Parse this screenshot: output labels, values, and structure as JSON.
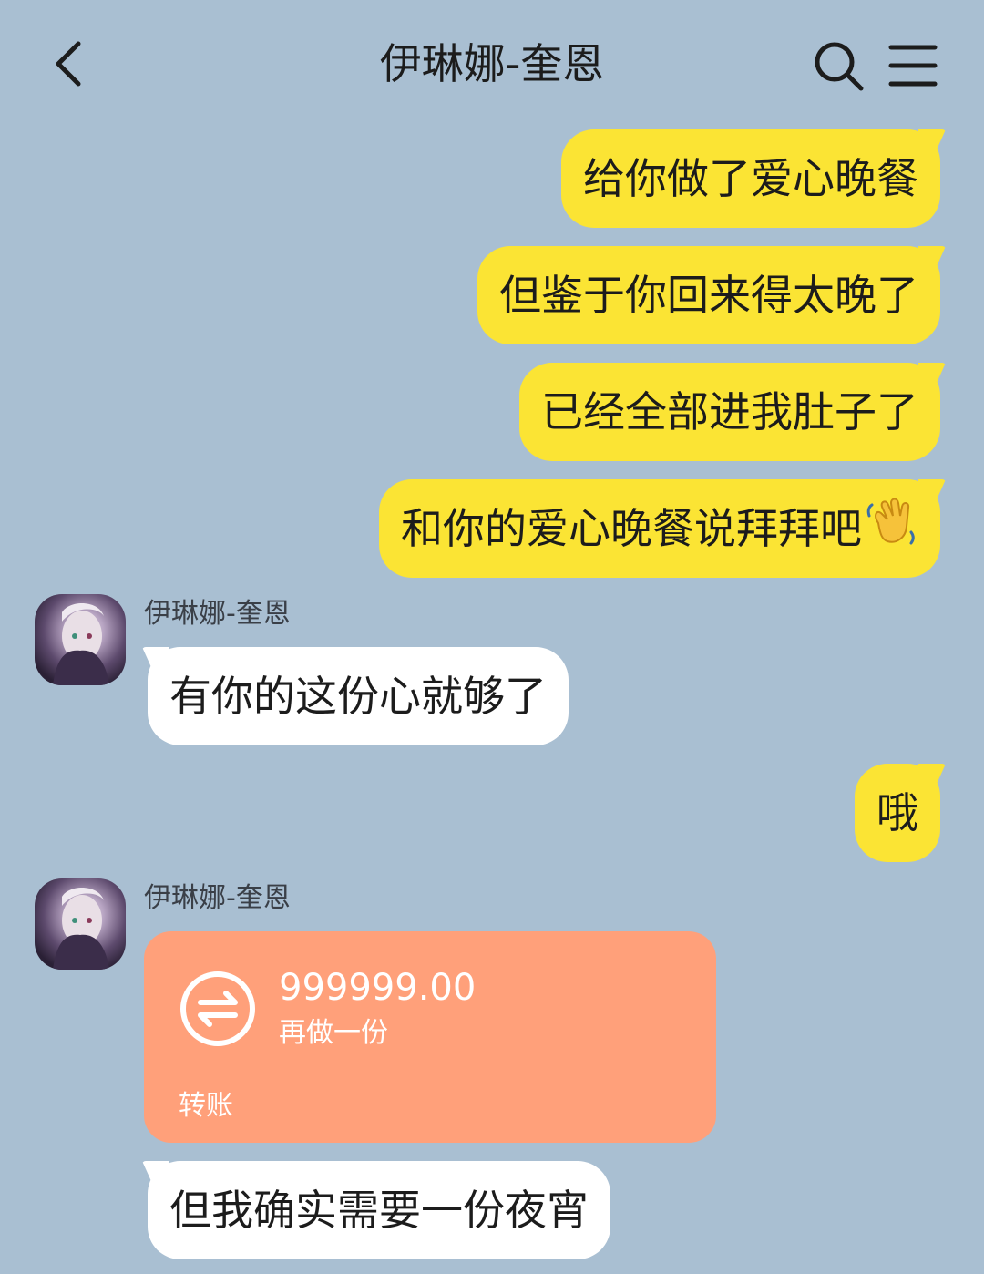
{
  "header": {
    "title": "伊琳娜-奎恩",
    "back_icon": "chevron-left-icon",
    "search_icon": "search-icon",
    "menu_icon": "menu-icon"
  },
  "messages": [
    {
      "side": "out",
      "text": "给你做了爱心晚餐"
    },
    {
      "side": "out",
      "text": "但鉴于你回来得太晚了"
    },
    {
      "side": "out",
      "text": "已经全部进我肚子了"
    },
    {
      "side": "out",
      "text": "和你的爱心晚餐说拜拜吧",
      "emoji": "waving-hand-icon"
    },
    {
      "side": "in",
      "sender": "伊琳娜-奎恩",
      "text": "有你的这份心就够了"
    },
    {
      "side": "out",
      "text": "哦"
    },
    {
      "side": "in",
      "sender": "伊琳娜-奎恩",
      "type": "transfer",
      "amount": "999999.00",
      "note": "再做一份",
      "label": "转账"
    },
    {
      "side": "in",
      "text": "但我确实需要一份夜宵"
    }
  ],
  "colors": {
    "background": "#a9bfd2",
    "outgoing_bubble": "#fbe434",
    "incoming_bubble": "#ffffff",
    "transfer_card": "#ffa07a"
  }
}
